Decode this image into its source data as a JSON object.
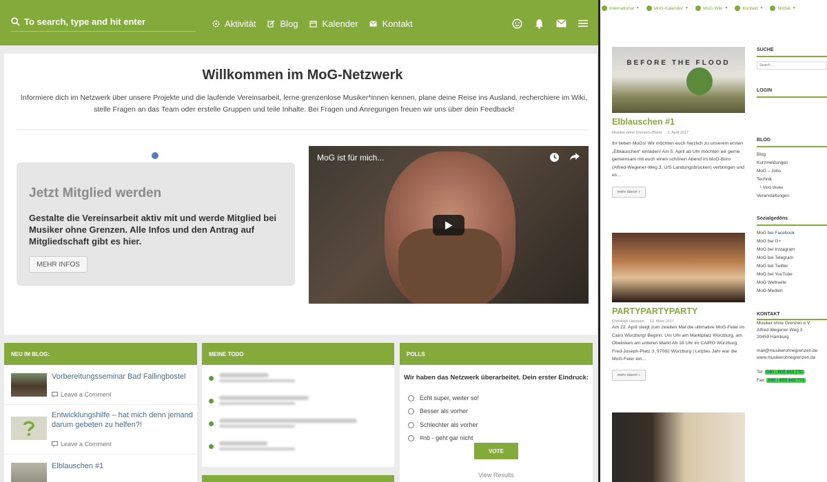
{
  "header": {
    "search_placeholder": "To search, type and hit enter",
    "nav": [
      {
        "label": "Aktivität"
      },
      {
        "label": "Blog"
      },
      {
        "label": "Kalender"
      },
      {
        "label": "Kontakt"
      }
    ],
    "accent_color": "#84aa3c"
  },
  "welcome": {
    "title": "Willkommen im MoG-Netzwerk",
    "intro": "Informiere dich im Netzwerk über unsere Projekte und die laufende Vereinsarbeit, lerne grenzenlose Musiker*innen kennen, plane deine Reise ins Ausland, recherchiere im Wiki, stelle Fragen an das Team oder erstelle Gruppen und teile Inhalte. Bei Fragen und Anregungen freuen wir uns über dein Feedback!",
    "member": {
      "title": "Jetzt Mitglied werden",
      "text": "Gestalte die Vereinsarbeit aktiv mit und werde Mitglied bei Musiker ohne Grenzen. Alle Infos und den Antrag auf Mitgliedschaft gibt es hier.",
      "button": "MEHR INFOS"
    },
    "video": {
      "title": "MoG ist für mich..."
    }
  },
  "cards": {
    "blog": {
      "title": "NEU IM BLOG:",
      "items": [
        {
          "title": "Vorbereitungsseminar Bad Fallingbostel",
          "comment": "Leave a Comment"
        },
        {
          "title": "Entwicklungshilfe – hat mich denn jemand darum gebeten zu helfen?!",
          "comment": "Leave a Comment"
        },
        {
          "title": "Elblauschen #1"
        }
      ]
    },
    "todo": {
      "title": "MEINE TODO"
    },
    "polls": {
      "title": "POLLS",
      "question": "Wir haben das Netzwerk überarbeitet. Dein erster Eindruck:",
      "options": [
        "Echt super, weiter so!",
        "Besser als vorher",
        "Schlechter als vorher",
        "#nö - geht gar nicht"
      ],
      "vote": "VOTE",
      "view_results": "View Results"
    }
  },
  "wp_bar": [
    {
      "label": "International"
    },
    {
      "label": "MoG-Kalender"
    },
    {
      "label": "MoG-Wiki"
    },
    {
      "label": "Kontakt"
    },
    {
      "label": "Notfall"
    }
  ],
  "posts": [
    {
      "image_text": "BEFORE THE FLOOD",
      "title": "Elblauschen #1",
      "author": "Musiker ohne Grenzen (Büro)",
      "date": "3. April 2017",
      "excerpt": "Ihr lieben MoGs! Wir möchten euch herzlich zu unserem ersten „Elblauschen“ einladen! Am 5. April ab Uhr möchten wir gerne gemeinsam mit euch einen schönen Abend im MoG-Büro (Alfred-Wegener-Weg 3, U/S Landungsbrücken) verbringen und es…",
      "more": "mehr davon »"
    },
    {
      "title": "PARTYPARTYPARTY",
      "author": "Christoph Hanssen",
      "date": "12. März 2017",
      "excerpt": "Am 22. April steigt zum zweiten Mal die ultimative MoG-Feier im Cairo Würzburg! Beginn: Um Uhr am Marktplatz Würzburg, am Obelisken am unteren Markt Ab 18 Uhr im CAIRO Würzburg Fred-Joseph-Platz 3, 97082 Würzburg | Letztes Jahr war die MoG-Feier ein…",
      "more": "mehr davon »"
    }
  ],
  "sidebar": {
    "search": {
      "title": "SUCHE",
      "placeholder": "Search ..."
    },
    "login": {
      "title": "LOGIN"
    },
    "blog": {
      "title": "BLOG",
      "links": [
        "Blog",
        "Kurzmeldungen",
        "MoG – Jobs",
        "Technik",
        "└ MoG-Wolke",
        "Veranstaltungen"
      ]
    },
    "social": {
      "title": "Sozialgedöns",
      "links": [
        "MoG bei Facebook",
        "MoG bei G+",
        "MoG bei Instagram",
        "MoG bei Telegram",
        "MoG bei Twitter",
        "MoG bei YouTube",
        "MoG Webseite",
        "MoG-Medien"
      ]
    },
    "contact": {
      "title": "KONTAKT",
      "line1": "Musiker ohne Grenzen e.V.",
      "line2": "Alfred-Wegener-Weg 3",
      "line3": "20459 Hamburg",
      "mail": "mail@musikerohnegrenzen.de",
      "web": "www.musikerohnegrenzen.de",
      "tel_label": "Tel:",
      "tel": "040 - 609 443 770",
      "fax_label": "Fax:",
      "fax": "040 - 609 443 771"
    }
  }
}
